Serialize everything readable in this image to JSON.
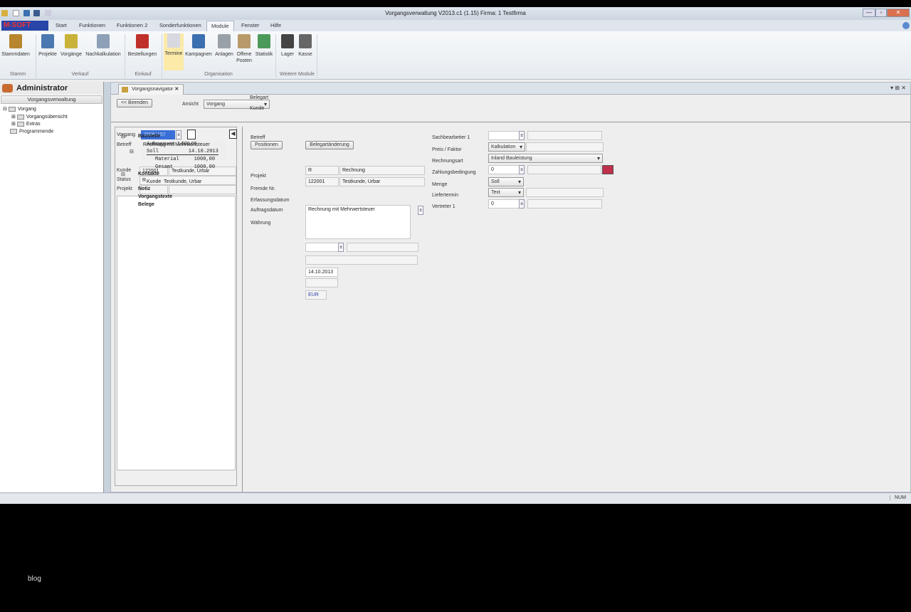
{
  "window": {
    "title": "Vorgangsverwaltung  V2013.c1 (1.15)     Firma: 1   Testfirma",
    "minimize": "—",
    "maximize": "▫",
    "close": "✕"
  },
  "app_menu": "M-SOFT",
  "ribbon_tabs": [
    "Start",
    "Funktionen",
    "Funktionen 2",
    "Sonderfunktionen",
    "Module",
    "Fenster",
    "Hilfe"
  ],
  "ribbon_buttons": [
    {
      "label": "Stammdaten",
      "color": "#b8862f"
    },
    {
      "label": "Projekte",
      "color": "#4a78b0"
    },
    {
      "label": "Vorgänge",
      "color": "#c9b23a"
    },
    {
      "label": "Nachkalkulation",
      "color": "#8ea0b8"
    },
    {
      "label": "Bestellungen",
      "color": "#c0302a"
    },
    {
      "label": "Termine",
      "color": "#d8d8e0"
    },
    {
      "label": "Kampagnen",
      "color": "#3a6fb0"
    },
    {
      "label": "Anlagen",
      "color": "#9aa0a8"
    },
    {
      "label": "Offene Posten",
      "color": "#b89a6a"
    },
    {
      "label": "Statistik",
      "color": "#4c9a5a"
    },
    {
      "label": "Lager",
      "color": "#444"
    },
    {
      "label": "Kasse",
      "color": "#666"
    }
  ],
  "ribbon_groups": [
    "Stamm",
    "Verkauf",
    "Einkauf",
    "Organisation",
    "Weitere Module"
  ],
  "sidebar": {
    "user": "Administrator",
    "header": "Vorgangsverwaltung",
    "tree": [
      "Vorgang",
      "Vorgangsübersicht",
      "Extras",
      "Programmende"
    ]
  },
  "doc_tab": "Vorgangsnavigator",
  "toolbar": {
    "back": "<< Beenden",
    "ansicht_label": "Ansicht",
    "ansicht_value": "Vorgang"
  },
  "left_form": {
    "vorgang_label": "Vorgang",
    "vorgang_value": "20081157",
    "betreff_label": "Betreff",
    "betreff_value": "Rechnung mit Mehrwertsteuer",
    "kunde_label": "Kunde",
    "kunde_nr": "122001",
    "kunde_name": "Testkunde, Urbar",
    "status_label": "Status",
    "status_value": "R",
    "projekt_label": "Projekt"
  },
  "info_tree": {
    "baustelle": "Baustelle",
    "auftragswert": "Auftragswert  1.000,00",
    "soll": "Soll          14.10.2013",
    "material": "Material     1000,00",
    "gesamt": "Gesamt       1000,00",
    "kontakte": "Kontakte",
    "kunde": "Kunde  Testkunde, Urbar",
    "notiz": "Notiz",
    "vorgangstexte": "Vorgangstexte",
    "belege": "Belege"
  },
  "mid_form": {
    "positionen": "Positionen",
    "belegart_aend": "Belegartänderung",
    "belegart_label": "Belegart",
    "belegart_code": "R",
    "belegart_name": "Rechnung",
    "kunde_label": "Kunde",
    "kunde_nr": "122001",
    "kunde_name": "Testkunde, Urbar",
    "betreff_label": "Betreff",
    "betreff_value": "Rechnung mit Mehrwertsteuer",
    "projekt_label": "Projekt",
    "fremde_label": "Fremde Nr.",
    "erfassung_label": "Erfassungsdatum",
    "erfassung_value": "14.10.2013",
    "auftrag_label": "Auftragsdatum",
    "waehrung_label": "Währung",
    "waehrung_value": "EUR"
  },
  "right_form": {
    "sachbearbeiter": "Sachbearbeiter 1",
    "preis": "Preis / Faktor",
    "preis_value": "Kalkulation",
    "rechnungsart": "Rechnungsart",
    "rechnungsart_value": "Inland Bauleistung",
    "zahlung": "Zahlungsbedingung",
    "zahlung_value": "0",
    "menge": "Menge",
    "menge_value": "Soll",
    "liefertermin": "Liefertermin",
    "liefertermin_value": "Text",
    "vertreter": "Vertreter 1",
    "vertreter_value": "0"
  },
  "statusbar": {
    "num": "NUM"
  },
  "watermark": "blog"
}
